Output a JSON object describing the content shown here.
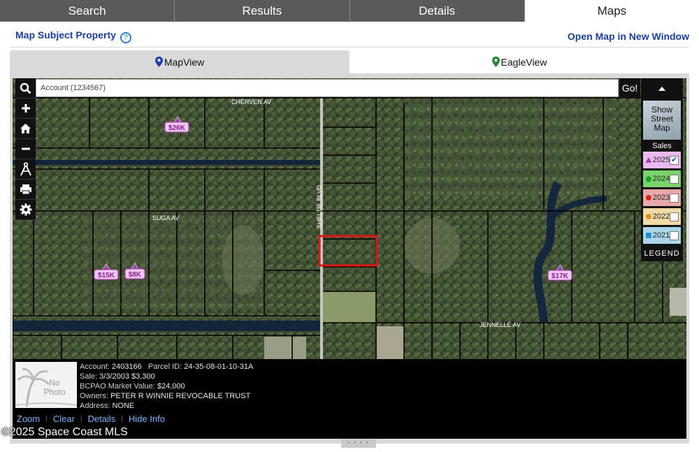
{
  "tabs": [
    "Search",
    "Results",
    "Details",
    "Maps"
  ],
  "active_tab": "Maps",
  "subheader": {
    "left_link": "Map Subject Property",
    "right_link": "Open Map in New Window"
  },
  "view_tabs": [
    "MapView",
    "EagleView"
  ],
  "search": {
    "placeholder": "Account (1234567)",
    "go": "Go!"
  },
  "toolbar_icons": [
    "search-icon",
    "zoom-in-icon",
    "home-icon",
    "zoom-out-icon",
    "measure-icon",
    "print-icon",
    "settings-icon"
  ],
  "legend": {
    "show_street_map": "Show Street Map",
    "sales": "Sales",
    "years": [
      {
        "year": "2025",
        "checked": true,
        "color": "#e9b9ef",
        "marker": "#9b3fb5",
        "shape": "triangle"
      },
      {
        "year": "2024",
        "checked": false,
        "color": "#79d26a",
        "marker": "#1a9e2c",
        "shape": "pentagon"
      },
      {
        "year": "2023",
        "checked": false,
        "color": "#e8a8a8",
        "marker": "#d41e1e",
        "shape": "circle"
      },
      {
        "year": "2022",
        "checked": false,
        "color": "#f2d9a6",
        "marker": "#e38e15",
        "shape": "circle"
      },
      {
        "year": "2021",
        "checked": false,
        "color": "#a9d6e8",
        "marker": "#1e8cd6",
        "shape": "square"
      }
    ],
    "legend_label": "LEGEND"
  },
  "map": {
    "streets": [
      "CHERVEN AV",
      "SUGA AV",
      "SHELTIE BLVD",
      "JENNELLE AV"
    ],
    "price_tags": [
      "$26K",
      "$15K",
      "$8K",
      "$17K"
    ]
  },
  "info": {
    "no_photo": [
      "No",
      "Photo"
    ],
    "account_label": "Account:",
    "account": "2403166",
    "parcel_label": "Parcel ID:",
    "parcel": "24-35-08-01-10-31A",
    "sale_label": "Sale:",
    "sale": "3/3/2003 $3,300",
    "market_label": "BCPAO Market Value:",
    "market": "$24,000",
    "owners_label": "Owners:",
    "owners": "PETER R WINNIE REVOCABLE TRUST",
    "address_label": "Address:",
    "address": "NONE",
    "actions": [
      "Zoom",
      "Clear",
      "Details",
      "Hide Info"
    ]
  },
  "copyright": "©2025 Space Coast MLS",
  "grip": "• • • •"
}
